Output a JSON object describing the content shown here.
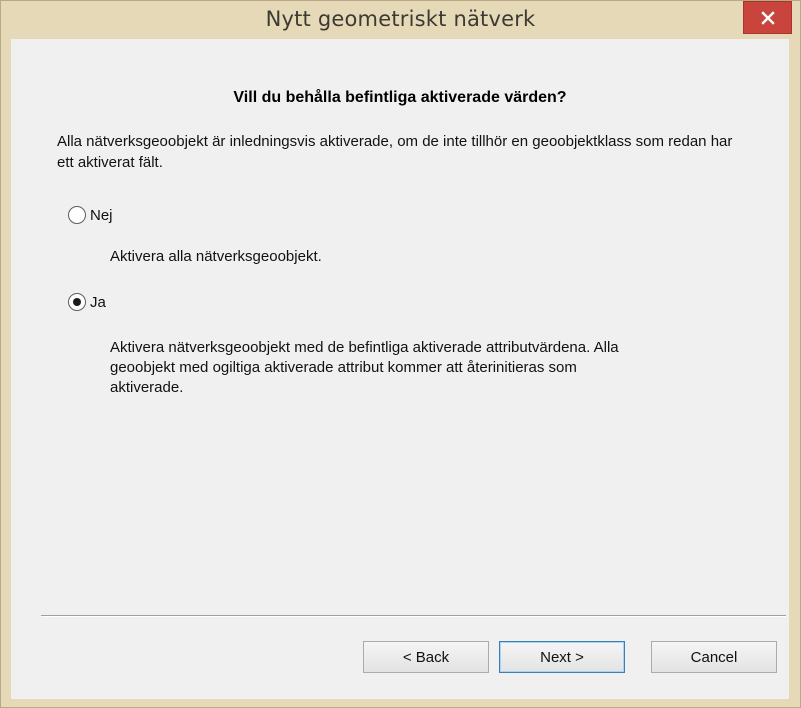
{
  "window": {
    "title": "Nytt geometriskt nätverk",
    "close_icon": "close-icon",
    "accent_color": "#c9443c"
  },
  "dialog": {
    "heading": "Vill du behålla befintliga aktiverade värden?",
    "intro": "Alla nätverksgeoobjekt är inledningsvis aktiverade, om de inte tillhör en geoobjektklass som redan har ett aktiverat fält.",
    "options": [
      {
        "label": "Nej",
        "checked": false,
        "description": "Aktivera alla nätverksgeoobjekt."
      },
      {
        "label": "Ja",
        "checked": true,
        "description": "Aktivera nätverksgeoobjekt med de befintliga aktiverade attributvärdena. Alla geoobjekt med ogiltiga aktiverade attribut kommer att återinitieras som aktiverade."
      }
    ]
  },
  "buttons": {
    "back": "< Back",
    "next": "Next >",
    "cancel": "Cancel"
  }
}
